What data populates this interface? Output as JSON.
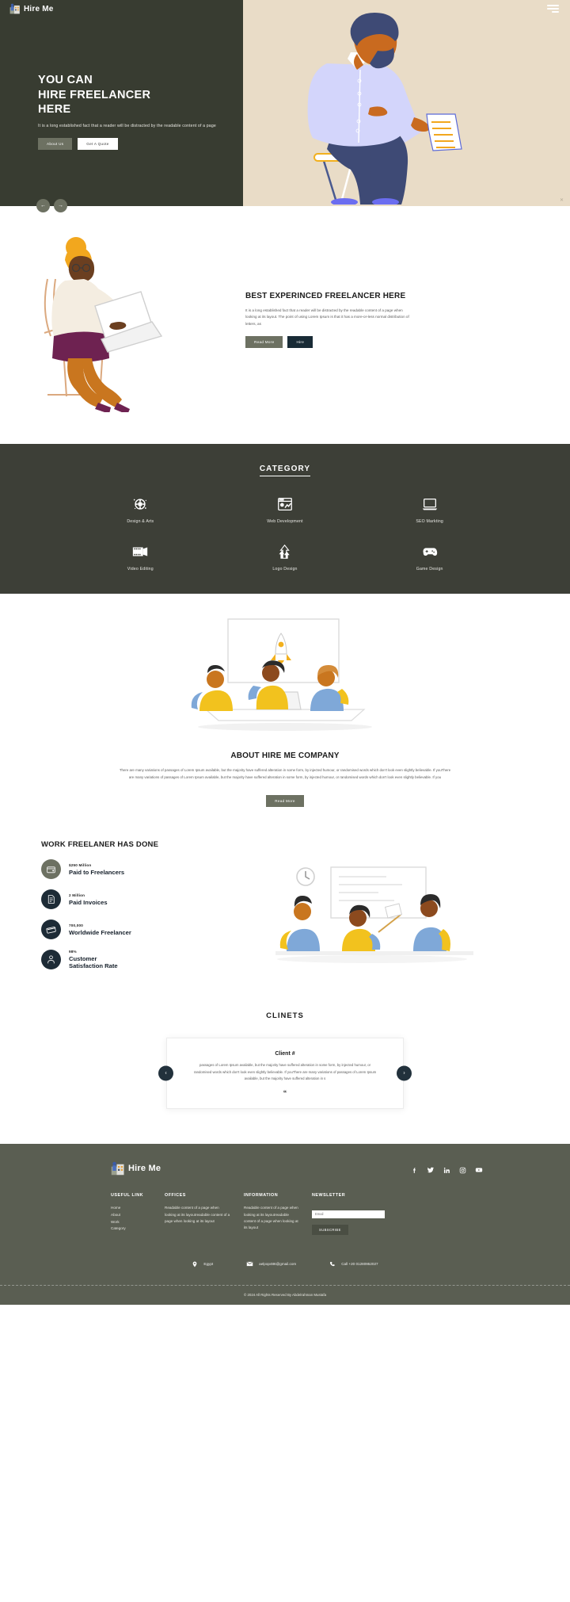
{
  "brand": {
    "name": "Hire Me",
    "logo_icon": "hire-me-logo"
  },
  "hero": {
    "title_line1": "YOU CAN",
    "title_line2": "HIRE FREELANCER",
    "title_line3": "HERE",
    "subtitle": "It is a long established fact that a reader will be distracted by the readable content of a page",
    "btn_about": "About Us",
    "btn_quote": "Get A Quote",
    "prev_icon": "arrow-left-icon",
    "next_icon": "arrow-right-icon",
    "menu_icon": "hamburger-menu-icon",
    "close_icon": "close-icon",
    "bg_left": "#383c31",
    "bg_right": "#e9dcc7"
  },
  "experience": {
    "heading": "BEST EXPERINCED FREELANCER HERE",
    "paragraph": "It is a long established fact that a reader will be distracted by the readable content of a page when looking at its layout. The point of using Lorem Ipsum is that it has a more-or-less normal distribution of letters, as",
    "btn_read_more": "Read More",
    "btn_hire": "Hire"
  },
  "category": {
    "title": "CATEGORY",
    "items": [
      {
        "label": "Design & Arts",
        "icon": "design-arts-icon"
      },
      {
        "label": "Web Development",
        "icon": "web-development-icon"
      },
      {
        "label": "SEO Markting",
        "icon": "seo-marketing-icon"
      },
      {
        "label": "Video Editing",
        "icon": "video-editing-icon"
      },
      {
        "label": "Logo Design",
        "icon": "logo-design-icon"
      },
      {
        "label": "Game Design",
        "icon": "game-design-icon"
      }
    ],
    "bg": "#3d3f37"
  },
  "about": {
    "heading": "ABOUT HIRE ME COMPANY",
    "paragraph": "There are many variations of passages of Lorem Ipsum available, but the majority have suffered alteration in some form, by injected humour, or randomised words which don't look even slightly believable. If youThere are many variations of passages of Lorem Ipsum available, but the majority have suffered alteration in some form, by injected humour, or randomised words which don't look even slightly believable. If you",
    "btn_read_more": "Read More"
  },
  "work": {
    "heading": "WORK FREELANER HAS DONE",
    "stats": [
      {
        "number": "$250 Million",
        "label": "Paid to Freelancers",
        "icon": "wallet-icon",
        "color": "#6d7162"
      },
      {
        "number": "2 Million",
        "label": "Paid Invoices",
        "icon": "invoice-icon",
        "color": "#1d2b36"
      },
      {
        "number": "700,000",
        "label": "Worldwide Freelancer",
        "icon": "card-icon",
        "color": "#1d2b36"
      },
      {
        "number": "98%",
        "label": "Customer\nSatisfaction Rate",
        "icon": "customer-icon",
        "color": "#1d2b36"
      }
    ]
  },
  "clients": {
    "title": "CLINETS",
    "name": "Client #",
    "text": "passages of Lorem Ipsum available, but the majority have suffered alteration in some form, by injected humour, or randomised words which don't look even slightly believable. If youThere are many variations of passages of Lorem Ipsum available, but the majority have suffered alteration in s",
    "quote_glyph": "“",
    "prev_icon": "chevron-left-icon",
    "next_icon": "chevron-right-icon"
  },
  "footer": {
    "brand_name": "Hire Me",
    "social": [
      "facebook-icon",
      "twitter-icon",
      "linkedin-icon",
      "instagram-icon",
      "youtube-icon"
    ],
    "col_useful": {
      "heading": "USEFUL LINK",
      "items": [
        "Home",
        "About",
        "Work",
        "Category"
      ]
    },
    "col_offices": {
      "heading": "OFFICES",
      "text": "Readable content of a page when looking at its layoutreadable content of a page when looking at its layout"
    },
    "col_information": {
      "heading": "INFORMATION",
      "text": "Readable content of a page when looking at its layoutreadable content of a page when looking at its layout"
    },
    "col_newsletter": {
      "heading": "NEWSLETTER",
      "placeholder": "Email",
      "button": "SUBSCRIBE"
    },
    "contact": [
      {
        "icon": "location-pin-icon",
        "text": "Egypt"
      },
      {
        "icon": "envelope-icon",
        "text": "aelpop486@gmail.com"
      },
      {
        "icon": "phone-icon",
        "text": "Call +20 01280952027"
      }
    ],
    "copyright": "© 2024 All Rights Reserved By Abdelrahman Mustafa",
    "bg": "#5a5e52"
  }
}
